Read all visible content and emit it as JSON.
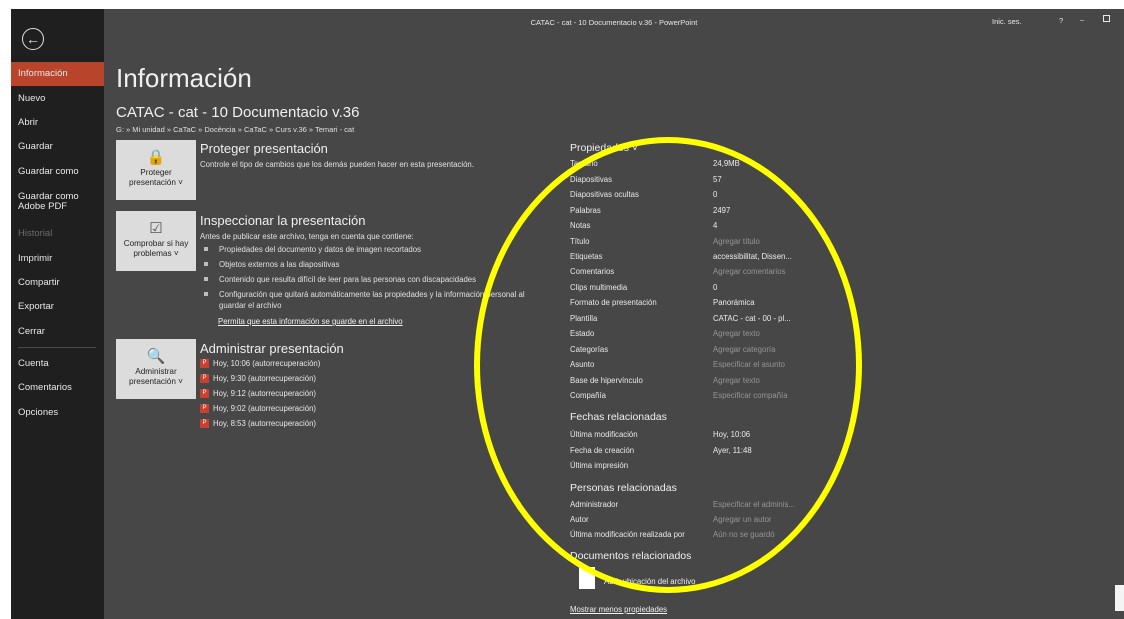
{
  "window": {
    "title": "CATAC - cat - 10 Documentacio v.36  -  PowerPoint",
    "signin": "Inic. ses.",
    "help": "?",
    "minimize": "–"
  },
  "nav": {
    "items": [
      {
        "label": "Información"
      },
      {
        "label": "Nuevo"
      },
      {
        "label": "Abrir"
      },
      {
        "label": "Guardar"
      },
      {
        "label": "Guardar como"
      },
      {
        "label": "Guardar como Adobe PDF"
      },
      {
        "label": "Historial"
      },
      {
        "label": "Imprimir"
      },
      {
        "label": "Compartir"
      },
      {
        "label": "Exportar"
      },
      {
        "label": "Cerrar"
      },
      {
        "label": "Cuenta"
      },
      {
        "label": "Comentarios"
      },
      {
        "label": "Opciones"
      }
    ]
  },
  "page": {
    "title": "Información",
    "doc_title": "CATAC - cat - 10 Documentacio v.36",
    "path": "G: » Mi unidad » CaTaC » Docència » CaTaC » Curs v.36 » Temari - cat"
  },
  "protect": {
    "tile": "Proteger presentación ˅",
    "title": "Proteger presentación",
    "desc": "Controle el tipo de cambios que los demás pueden hacer en esta presentación."
  },
  "inspect": {
    "tile": "Comprobar si hay problemas ˅",
    "title": "Inspeccionar la presentación",
    "desc": "Antes de publicar este archivo, tenga en cuenta que contiene:",
    "bullets": [
      "Propiedades del documento y datos de imagen recortados",
      "Objetos externos a las diapositivas",
      "Contenido que resulta difícil de leer para las personas con discapacidades",
      "Configuración que quitará automáticamente las propiedades y la información personal al guardar el archivo"
    ],
    "link": "Permita que esta información se guarde en el archivo"
  },
  "manage": {
    "tile": "Administrar presentación ˅",
    "title": "Administrar presentación",
    "versions": [
      "Hoy, 10:06 (autorrecuperación)",
      "Hoy, 9:30 (autorrecuperación)",
      "Hoy, 9:12 (autorrecuperación)",
      "Hoy, 9:02 (autorrecuperación)",
      "Hoy, 8:53 (autorrecuperación)"
    ]
  },
  "properties": {
    "title": "Propiedades ˅",
    "rows": [
      {
        "key": "Tamaño",
        "value": "24,9MB"
      },
      {
        "key": "Diapositivas",
        "value": "57"
      },
      {
        "key": "Diapositivas ocultas",
        "value": "0"
      },
      {
        "key": "Palabras",
        "value": "2497"
      },
      {
        "key": "Notas",
        "value": "4"
      },
      {
        "key": "Título",
        "value": "Agregar título"
      },
      {
        "key": "Etiquetas",
        "value": "accessibilitat, Dissen..."
      },
      {
        "key": "Comentarios",
        "value": "Agregar comentarios"
      },
      {
        "key": "Clips multimedia",
        "value": "0"
      },
      {
        "key": "Formato de presentación",
        "value": "Panorámica"
      },
      {
        "key": "Plantilla",
        "value": "CATAC - cat - 00 - pl..."
      },
      {
        "key": "Estado",
        "value": "Agregar texto"
      },
      {
        "key": "Categorías",
        "value": "Agregar categoría"
      },
      {
        "key": "Asunto",
        "value": "Especificar el asunto"
      },
      {
        "key": "Base de hipervínculo",
        "value": "Agregar texto"
      },
      {
        "key": "Compañía",
        "value": "Especificar compañía"
      }
    ]
  },
  "dates": {
    "title": "Fechas relacionadas",
    "rows": [
      {
        "key": "Última modificación",
        "value": "Hoy, 10:06"
      },
      {
        "key": "Fecha de creación",
        "value": "Ayer, 11:48"
      },
      {
        "key": "Última impresión",
        "value": ""
      }
    ]
  },
  "people": {
    "title": "Personas relacionadas",
    "rows": [
      {
        "key": "Administrador",
        "value": "Especificar el adminis..."
      },
      {
        "key": "Autor",
        "value": "Agregar un autor"
      },
      {
        "key": "Última modificación realizada por",
        "value": "Aún no se guardó"
      }
    ]
  },
  "docs": {
    "title": "Documentos relacionados",
    "open_location": "Abrir ubicación del archivo",
    "show_less": "Mostrar menos propiedades"
  }
}
